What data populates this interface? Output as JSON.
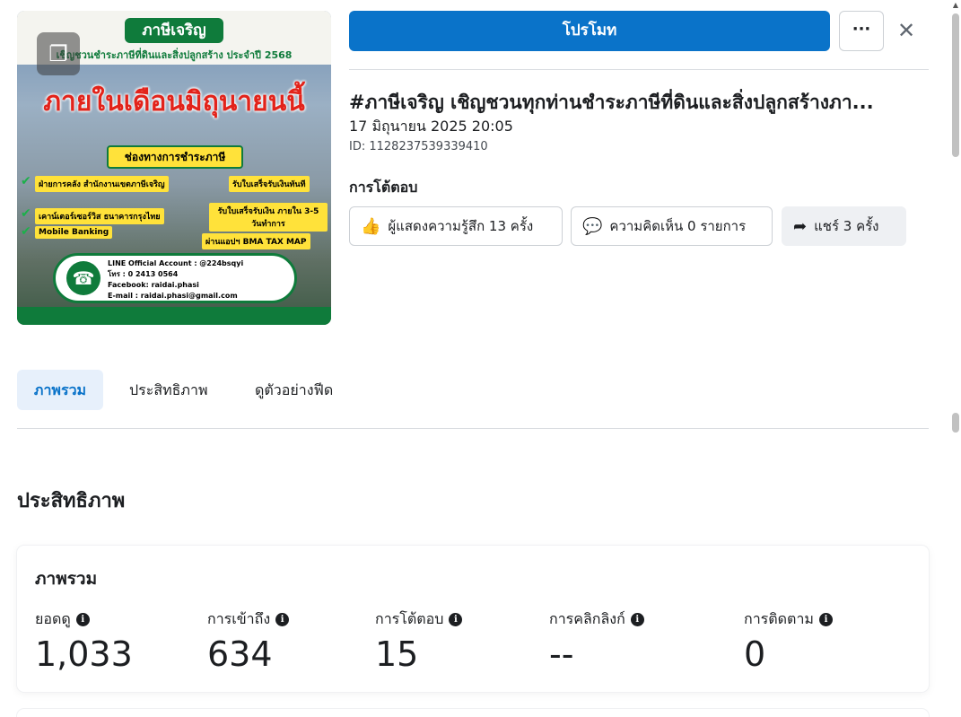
{
  "thumbnail": {
    "header_title": "ภาษีเจริญ",
    "header_sub": "เชิญชวนชำระภาษีที่ดินและสิ่งปลูกสร้าง ประจำปี 2568",
    "headline": "ภายในเดือนมิถุนายนนี้",
    "channels_title": "ช่องทางการชำระภาษี",
    "tags": [
      "ฝ่ายการคลัง สำนักงานเขตภาษีเจริญ",
      "รับใบเสร็จรับเงินทันที",
      "เคาน์เตอร์เซอร์วิส ธนาคารกรุงไทย",
      "รับใบเสร็จรับเงิน ภายใน 3-5 วันทำการ",
      "Mobile Banking",
      "ผ่านแอปฯ BMA TAX MAP"
    ],
    "contact_lines": [
      "LINE Official Account : @224bsqyi",
      "โทร : 0 2413 0564",
      "Facebook: raidai.phasi",
      "E-mail : raidai.phasi@gmail.com"
    ],
    "gallery_icon": "gallery-icon"
  },
  "header": {
    "promote_label": "โปรโมท",
    "more_label": "···",
    "close_label": "✕"
  },
  "post": {
    "title": "#ภาษีเจริญ เชิญชวนทุกท่านชำระภาษีที่ดินและสิ่งปลูกสร้างภา...",
    "date": "17 มิถุนายน 2025 20:05",
    "id": "ID: 1128237539339410"
  },
  "engagement": {
    "title": "การโต้ตอบ",
    "reactions_label": "ผู้แสดงความรู้สึก 13 ครั้ง",
    "comments_label": "ความคิดเห็น 0 รายการ",
    "shares_label": "แชร์ 3 ครั้ง"
  },
  "tabs": [
    {
      "label": "ภาพรวม",
      "active": true
    },
    {
      "label": "ประสิทธิภาพ",
      "active": false
    },
    {
      "label": "ดูตัวอย่างฟีด",
      "active": false
    }
  ],
  "performance": {
    "section_title": "ประสิทธิภาพ",
    "card_title": "ภาพรวม",
    "metrics": [
      {
        "label": "ยอดดู",
        "value": "1,033"
      },
      {
        "label": "การเข้าถึง",
        "value": "634"
      },
      {
        "label": "การโต้ตอบ",
        "value": "15"
      },
      {
        "label": "การคลิกลิงก์",
        "value": "--"
      },
      {
        "label": "การติดตาม",
        "value": "0"
      }
    ]
  },
  "colors": {
    "primary": "#0a73c9",
    "tab_active_bg": "#e7f0fb",
    "brand_green": "#0f7b3b"
  }
}
